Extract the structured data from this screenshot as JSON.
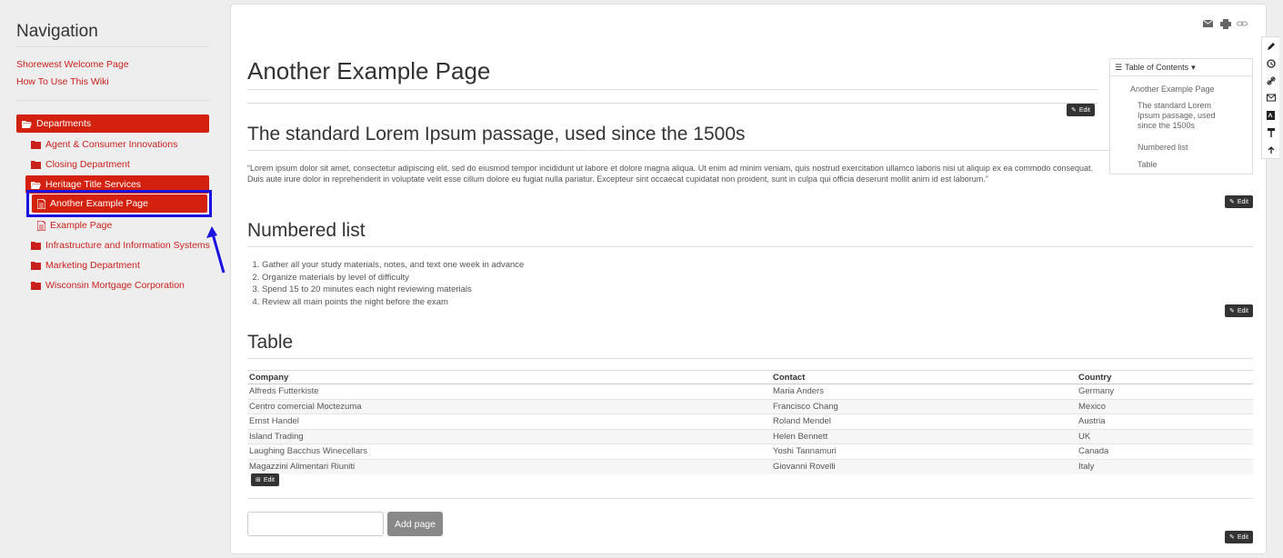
{
  "sidebar": {
    "title": "Navigation",
    "links": [
      "Shorewest Welcome Page",
      "How To Use This Wiki"
    ],
    "tree": [
      {
        "label": "Departments",
        "level": 0,
        "active": true,
        "icon": "folder-open-icon"
      },
      {
        "label": "Agent & Consumer Innovations",
        "level": 1,
        "active": false,
        "icon": "folder-icon"
      },
      {
        "label": "Closing Department",
        "level": 1,
        "active": false,
        "icon": "folder-icon"
      },
      {
        "label": "Heritage Title Services",
        "level": 1,
        "active": true,
        "icon": "folder-open-icon"
      },
      {
        "label": "Another Example Page",
        "level": 2,
        "active": true,
        "icon": "page-icon"
      },
      {
        "label": "Example Page",
        "level": 2,
        "active": false,
        "icon": "page-icon"
      },
      {
        "label": "Infrastructure and Information Systems",
        "level": 1,
        "active": false,
        "icon": "folder-icon"
      },
      {
        "label": "Marketing Department",
        "level": 1,
        "active": false,
        "icon": "folder-icon"
      },
      {
        "label": "Wisconsin Mortgage Corporation",
        "level": 1,
        "active": false,
        "icon": "folder-icon"
      }
    ]
  },
  "page": {
    "title": "Another Example Page",
    "section1": {
      "heading": "The standard Lorem Ipsum passage, used since the 1500s",
      "text": "“Lorem ipsum dolor sit amet, consectetur adipiscing elit, sed do eiusmod tempor incididunt ut labore et dolore magna aliqua. Ut enim ad minim veniam, quis nostrud exercitation ullamco laboris nisi ut aliquip ex ea commodo consequat. Duis aute irure dolor in reprehenderit in voluptate velit esse cillum dolore eu fugiat nulla pariatur. Excepteur sint occaecat cupidatat non proident, sunt in culpa qui officia deserunt mollit anim id est laborum.”"
    },
    "section2": {
      "heading": "Numbered list",
      "items": [
        "Gather all your study materials, notes, and text one week in advance",
        "Organize materials by level of difficulty",
        "Spend 15 to 20 minutes each night reviewing materials",
        "Review all main points the night before the exam"
      ]
    },
    "section3": {
      "heading": "Table",
      "columns": [
        "Company",
        "Contact",
        "Country"
      ],
      "rows": [
        [
          "Alfreds Futterkiste",
          "Maria Anders",
          "Germany"
        ],
        [
          "Centro comercial Moctezuma",
          "Francisco Chang",
          "Mexico"
        ],
        [
          "Ernst Handel",
          "Roland Mendel",
          "Austria"
        ],
        [
          "Island Trading",
          "Helen Bennett",
          "UK"
        ],
        [
          "Laughing Bacchus Winecellars",
          "Yoshi Tannamuri",
          "Canada"
        ],
        [
          "Magazzini Alimentari Riuniti",
          "Giovanni Rovelli",
          "Italy"
        ]
      ]
    },
    "edit_label": "Edit",
    "add_page_label": "Add page"
  },
  "toc": {
    "title": "Table of Contents",
    "items": [
      "Another Example Page",
      "The standard Lorem Ipsum passage, used since the 1500s",
      "Numbered list",
      "Table"
    ]
  },
  "colors": {
    "accent": "#d4200f",
    "highlight": "#1a12e0"
  }
}
